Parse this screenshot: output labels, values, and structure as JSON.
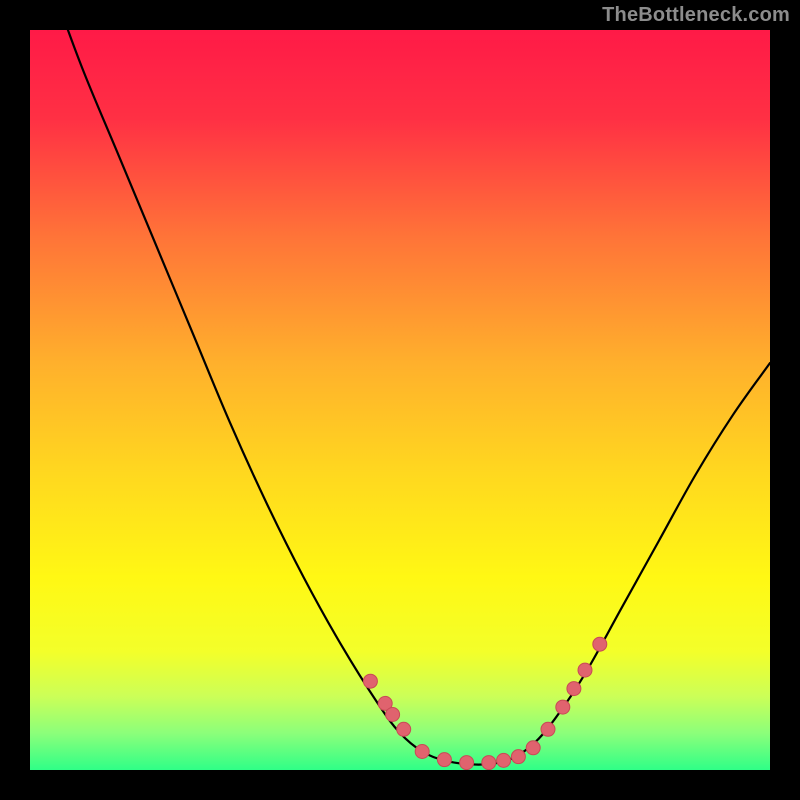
{
  "attribution": "TheBottleneck.com",
  "chart_data": {
    "type": "line",
    "title": "",
    "xlabel": "",
    "ylabel": "",
    "xlim": [
      0,
      100
    ],
    "ylim": [
      0,
      100
    ],
    "curve": {
      "x": [
        0,
        3,
        7,
        12,
        17,
        22,
        27,
        32,
        37,
        42,
        47,
        50,
        53,
        56,
        59,
        62,
        65,
        68,
        71,
        75,
        80,
        85,
        90,
        95,
        100
      ],
      "y": [
        115,
        106,
        95,
        83,
        71,
        59,
        47,
        36,
        26,
        17,
        9,
        5,
        2.5,
        1.3,
        0.8,
        0.8,
        1.5,
        3.5,
        7,
        13,
        22,
        31,
        40,
        48,
        55
      ]
    },
    "points": {
      "x": [
        46,
        48,
        49,
        50.5,
        53,
        56,
        59,
        62,
        64,
        66,
        68,
        70,
        72,
        73.5,
        75,
        77
      ],
      "y": [
        12,
        9,
        7.5,
        5.5,
        2.5,
        1.4,
        1.0,
        1.0,
        1.3,
        1.8,
        3.0,
        5.5,
        8.5,
        11,
        13.5,
        17
      ]
    },
    "gradient_stops": [
      {
        "offset": 0.0,
        "color": "#ff1a47"
      },
      {
        "offset": 0.12,
        "color": "#ff3044"
      },
      {
        "offset": 0.28,
        "color": "#ff7438"
      },
      {
        "offset": 0.45,
        "color": "#ffb02c"
      },
      {
        "offset": 0.6,
        "color": "#ffd81f"
      },
      {
        "offset": 0.74,
        "color": "#fff814"
      },
      {
        "offset": 0.84,
        "color": "#f3ff2a"
      },
      {
        "offset": 0.9,
        "color": "#ccff57"
      },
      {
        "offset": 0.95,
        "color": "#8cff7a"
      },
      {
        "offset": 1.0,
        "color": "#2fff87"
      }
    ],
    "point_fill": "#e0636e",
    "point_stroke": "#c94a56",
    "point_radius": 7
  }
}
